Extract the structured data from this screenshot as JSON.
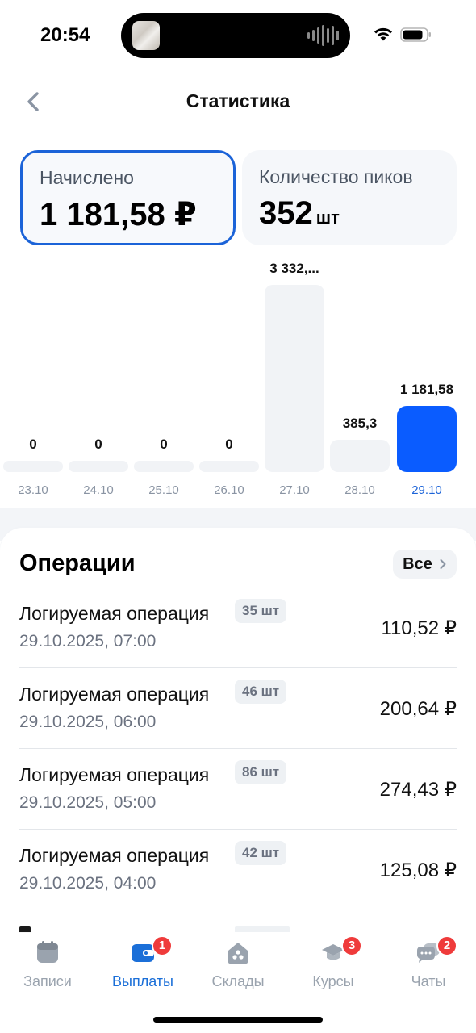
{
  "status_bar": {
    "time": "20:54"
  },
  "header": {
    "title": "Статистика",
    "back_icon": "chevron-left-icon"
  },
  "cards": {
    "accrued": {
      "label": "Начислено",
      "value": "1 181,58 ₽"
    },
    "picks": {
      "label": "Количество пиков",
      "value": "352",
      "unit": "шт"
    }
  },
  "chart_data": {
    "type": "bar",
    "categories": [
      "23.10",
      "24.10",
      "25.10",
      "26.10",
      "27.10",
      "28.10",
      "29.10"
    ],
    "values": [
      0,
      0,
      0,
      0,
      3332,
      385.3,
      1181.58
    ],
    "value_labels": [
      "0",
      "0",
      "0",
      "0",
      "3 332,...",
      "385,3",
      "1 181,58"
    ],
    "selected_index": 6,
    "colors": {
      "bar": "#f1f3f6",
      "selected": "#0a5cff"
    }
  },
  "operations": {
    "title": "Операции",
    "all_label": "Все",
    "items": [
      {
        "name": "Логируемая операция",
        "qty": "35 шт",
        "date": "29.10.2025, 07:00",
        "amount": "110,52 ₽"
      },
      {
        "name": "Логируемая операция",
        "qty": "46 шт",
        "date": "29.10.2025, 06:00",
        "amount": "200,64 ₽"
      },
      {
        "name": "Логируемая операция",
        "qty": "86 шт",
        "date": "29.10.2025, 05:00",
        "amount": "274,43 ₽"
      },
      {
        "name": "Логируемая операция",
        "qty": "42 шт",
        "date": "29.10.2025, 04:00",
        "amount": "125,08 ₽"
      }
    ]
  },
  "tabbar": {
    "items": [
      {
        "label": "Записи",
        "icon": "calendar-icon",
        "badge": ""
      },
      {
        "label": "Выплаты",
        "icon": "wallet-icon",
        "badge": "1",
        "active": true
      },
      {
        "label": "Склады",
        "icon": "warehouse-icon",
        "badge": ""
      },
      {
        "label": "Курсы",
        "icon": "graduation-cap-icon",
        "badge": "3"
      },
      {
        "label": "Чаты",
        "icon": "chat-icon",
        "badge": "2"
      }
    ]
  },
  "colors": {
    "accent": "#1b63d8",
    "primary_bar": "#0a5cff",
    "badge": "#ef3b3b"
  }
}
